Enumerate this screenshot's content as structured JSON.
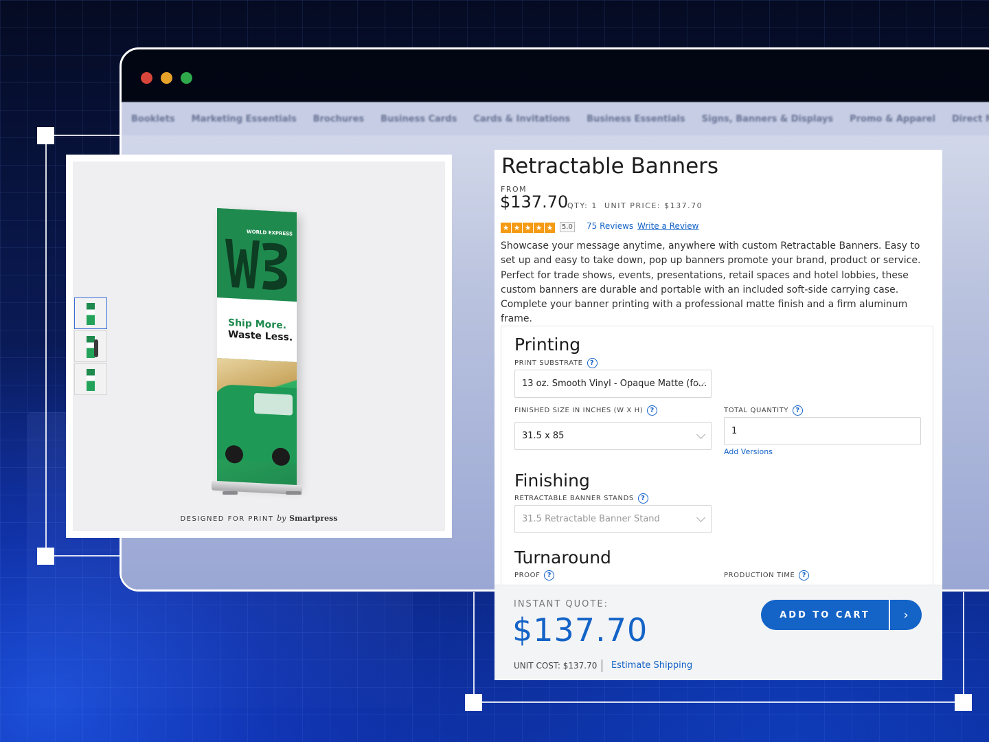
{
  "site_nav": [
    "Booklets",
    "Marketing Essentials",
    "Brochures",
    "Business Cards",
    "Cards & Invitations",
    "Business Essentials",
    "Signs, Banners & Displays",
    "Promo & Apparel",
    "Direct Mail"
  ],
  "gallery": {
    "banner_brand": "WORLD EXPRESS",
    "banner_tagline_1": "Ship More.",
    "banner_tagline_2": "Waste Less.",
    "caption_prefix": "DESIGNED FOR PRINT",
    "caption_by": "by",
    "caption_brand": "Smartpress",
    "thumbnails": [
      "thumb-1",
      "thumb-2",
      "thumb-3"
    ],
    "active_thumbnail": 0
  },
  "product": {
    "title": "Retractable Banners",
    "from_label": "FROM",
    "price": "$137.70",
    "qty": "QTY: 1",
    "unit_price": "UNIT PRICE: $137.70",
    "rating": 5.0,
    "rating_label": "5.0",
    "reviews_link": "75 Reviews",
    "write_review": "Write a Review",
    "description": "Showcase your message anytime, anywhere with custom Retractable Banners. Easy to set up and easy to take down, pop up banners promote your brand, product or service. Perfect for trade shows, events, presentations, retail spaces and hotel lobbies, these custom banners are durable and portable with an included soft-side carrying case. Complete your banner printing with a professional matte finish and a firm aluminum frame."
  },
  "options": {
    "printing_title": "Printing",
    "print_substrate_label": "PRINT SUBSTRATE",
    "print_substrate_value": "13 oz. Smooth Vinyl - Opaque Matte (fo...",
    "finished_size_label": "FINISHED SIZE IN INCHES (W X H)",
    "finished_size_value": "31.5 x 85",
    "total_quantity_label": "TOTAL QUANTITY",
    "total_quantity_value": "1",
    "add_versions": "Add Versions",
    "finishing_title": "Finishing",
    "stands_label": "RETRACTABLE BANNER STANDS",
    "stands_value": "31.5 Retractable Banner Stand",
    "turnaround_title": "Turnaround",
    "proof_label": "PROOF",
    "production_time_label": "PRODUCTION TIME"
  },
  "quote": {
    "label": "INSTANT QUOTE:",
    "price": "$137.70",
    "unit_cost": "UNIT COST: $137.70",
    "estimate_shipping": "Estimate Shipping",
    "add_to_cart": "ADD TO CART"
  },
  "colors": {
    "accent": "#1463c7",
    "star": "#f49a13",
    "brand_green": "#1f8a4e"
  }
}
